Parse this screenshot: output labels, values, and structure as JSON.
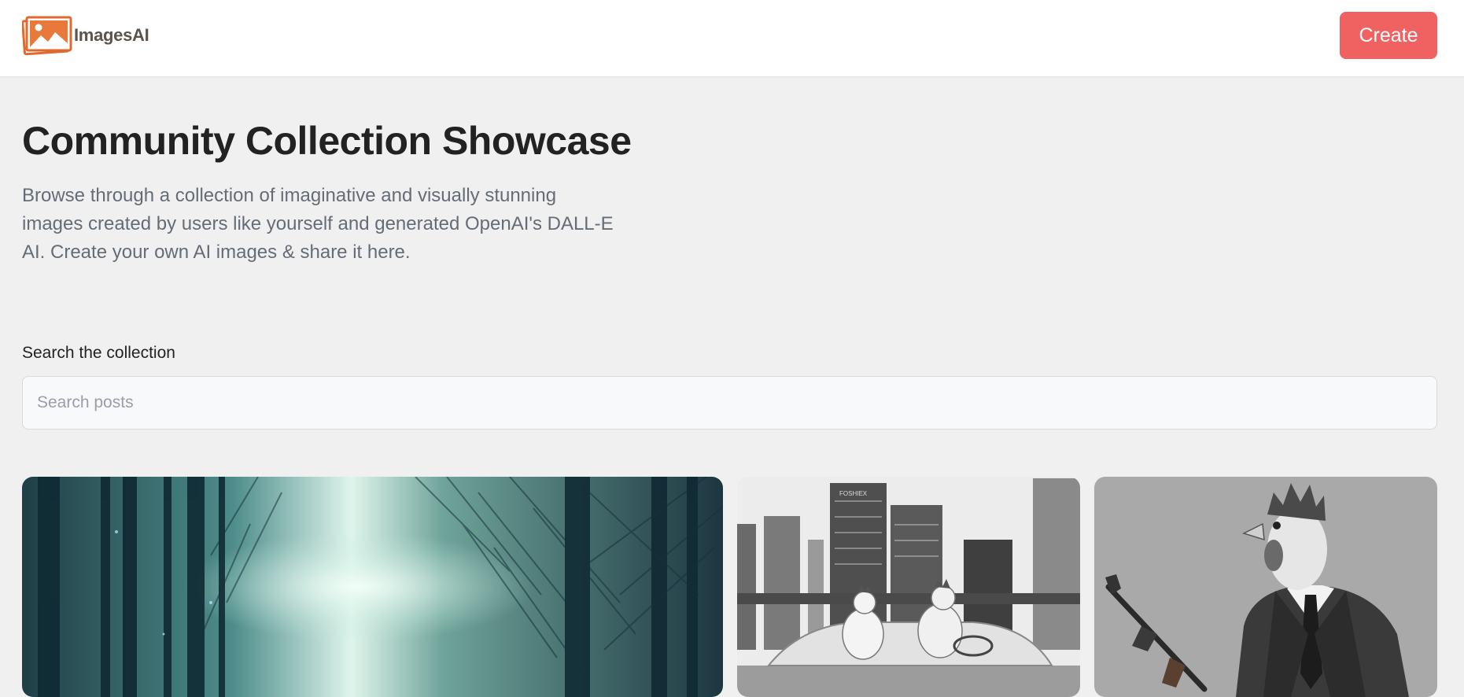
{
  "header": {
    "logo_text": "ImagesAI",
    "logo_icon": "picture-icon",
    "create_label": "Create"
  },
  "hero": {
    "title": "Community Collection Showcase",
    "description": "Browse through a collection of imaginative and visually stunning images created by users like yourself and generated OpenAI's DALL-E AI. Create your own AI images & share it here."
  },
  "search": {
    "label": "Search the collection",
    "placeholder": "Search posts",
    "value": ""
  },
  "gallery": {
    "cards": [
      {
        "subject": "misty forest road"
      },
      {
        "subject": "chickens driving a convertible in a city",
        "sign_text": "FOSHIEX"
      },
      {
        "subject": "rooster in a business suit with a rifle"
      }
    ]
  },
  "colors": {
    "accent": "#f06262",
    "logo_orange": "#e06a2e",
    "background": "#f0f0f0",
    "header_bg": "#ffffff"
  }
}
